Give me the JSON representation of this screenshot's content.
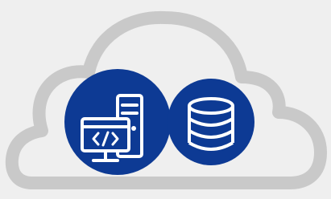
{
  "colors": {
    "background": "#efefef",
    "cloud_outline": "#c9c9c9",
    "badge_fill": "#0d3a94",
    "icon_stroke": "#ffffff"
  },
  "icons": {
    "cloud": "cloud-outline-icon",
    "left_badge": "code-computer-server-icon",
    "right_badge": "database-icon"
  }
}
